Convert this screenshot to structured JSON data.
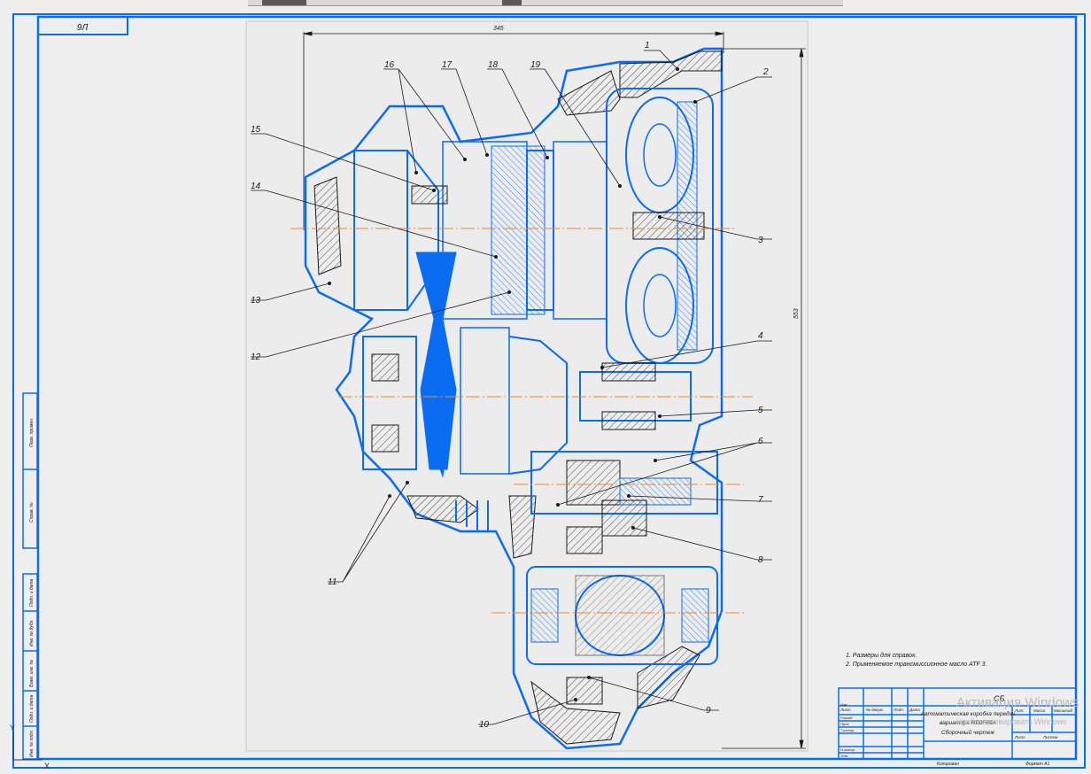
{
  "sheet": {
    "format_tag": "9Л",
    "overall_width_dim": "345",
    "overall_height_dim": "553"
  },
  "callouts": [
    "1",
    "2",
    "3",
    "4",
    "5",
    "6",
    "7",
    "8",
    "9",
    "10",
    "11",
    "12",
    "13",
    "14",
    "15",
    "16",
    "17",
    "18",
    "19"
  ],
  "notes": [
    "1. Размеры для справок.",
    "2. Применяемое трансмиссионное масло ATF 3."
  ],
  "title_block": {
    "doc_code": "СБ",
    "title_line1": "Автоматическая коробка передач",
    "title_line2": "вариатора RE0F09A",
    "title_line3": "Сборочный чертеж",
    "col_lit": "Лит.",
    "col_mass": "Масса",
    "col_scale": "Масштаб",
    "sheet_label": "Лист",
    "sheets_label": "Листов",
    "roles": [
      "Изм.",
      "Разраб.",
      "Пров.",
      "Т.контр.",
      "Н.контр.",
      "Утв."
    ],
    "cols": [
      "Лист",
      "№ докум.",
      "Подп.",
      "Дата"
    ],
    "copied": "Копировал",
    "format": "Формат  A1"
  },
  "left_stamp": [
    "Перв. примен.",
    "Справ. №",
    "Подп. и дата",
    "Инв. № дубл.",
    "Взам. инв. №",
    "Подп. и дата",
    "Инв. № подл."
  ],
  "watermark": {
    "line1": "Активация Windows",
    "line2": "Чтобы активировать Windows"
  },
  "axis_marker": {
    "y": "Y",
    "x": "X"
  }
}
